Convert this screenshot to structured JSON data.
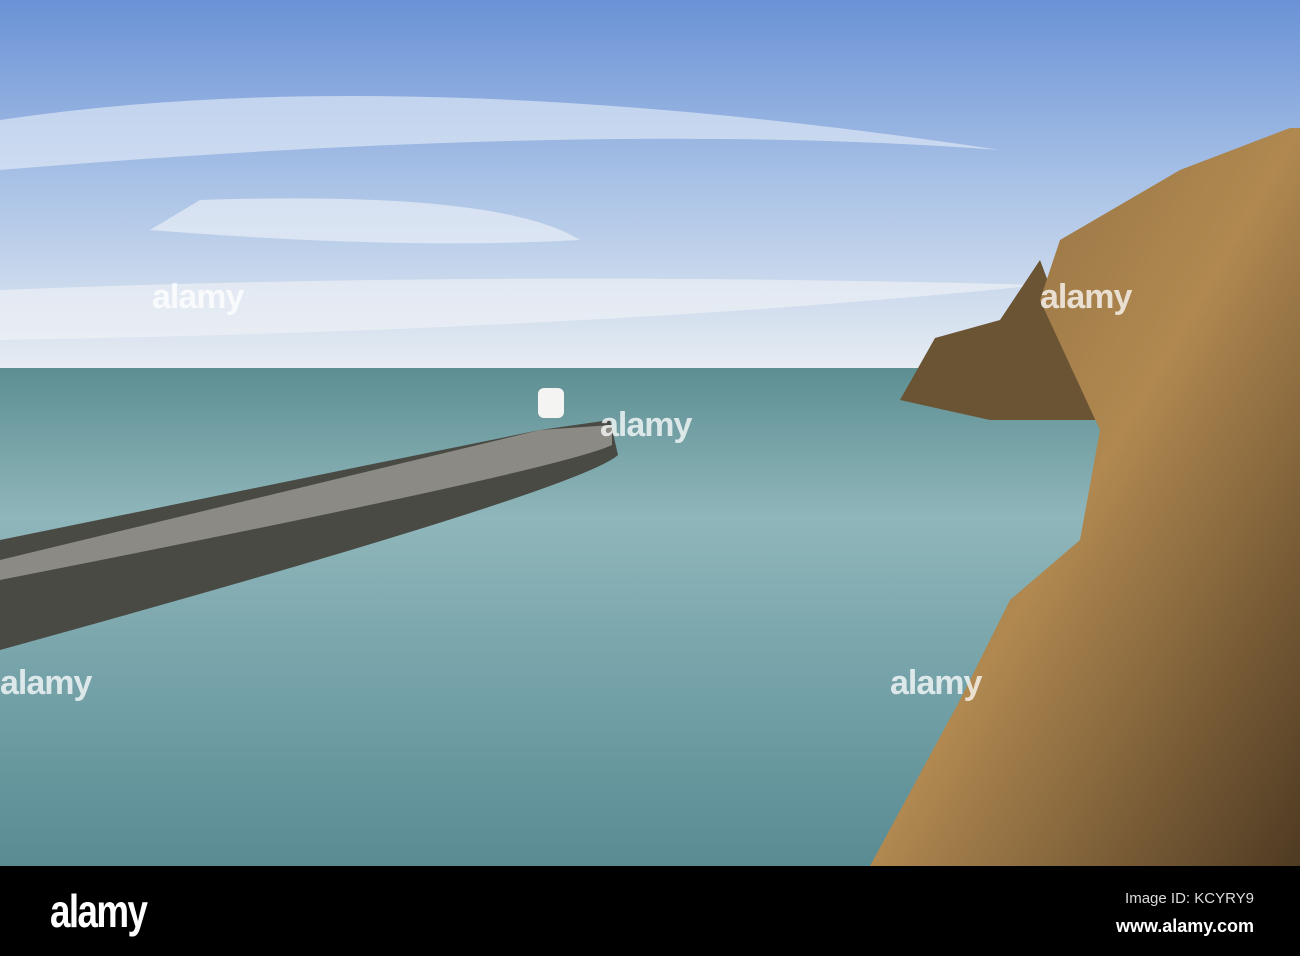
{
  "watermark": "alamy",
  "footer": {
    "logo": "alamy",
    "image_id": "Image ID: KCYRY9",
    "website": "www.alamy.com"
  },
  "colors": {
    "sky_top": "#5f8fd8",
    "sky_horizon": "#e4ebf3",
    "sea": "#6e9ea3",
    "cliff": "#9a7444"
  }
}
